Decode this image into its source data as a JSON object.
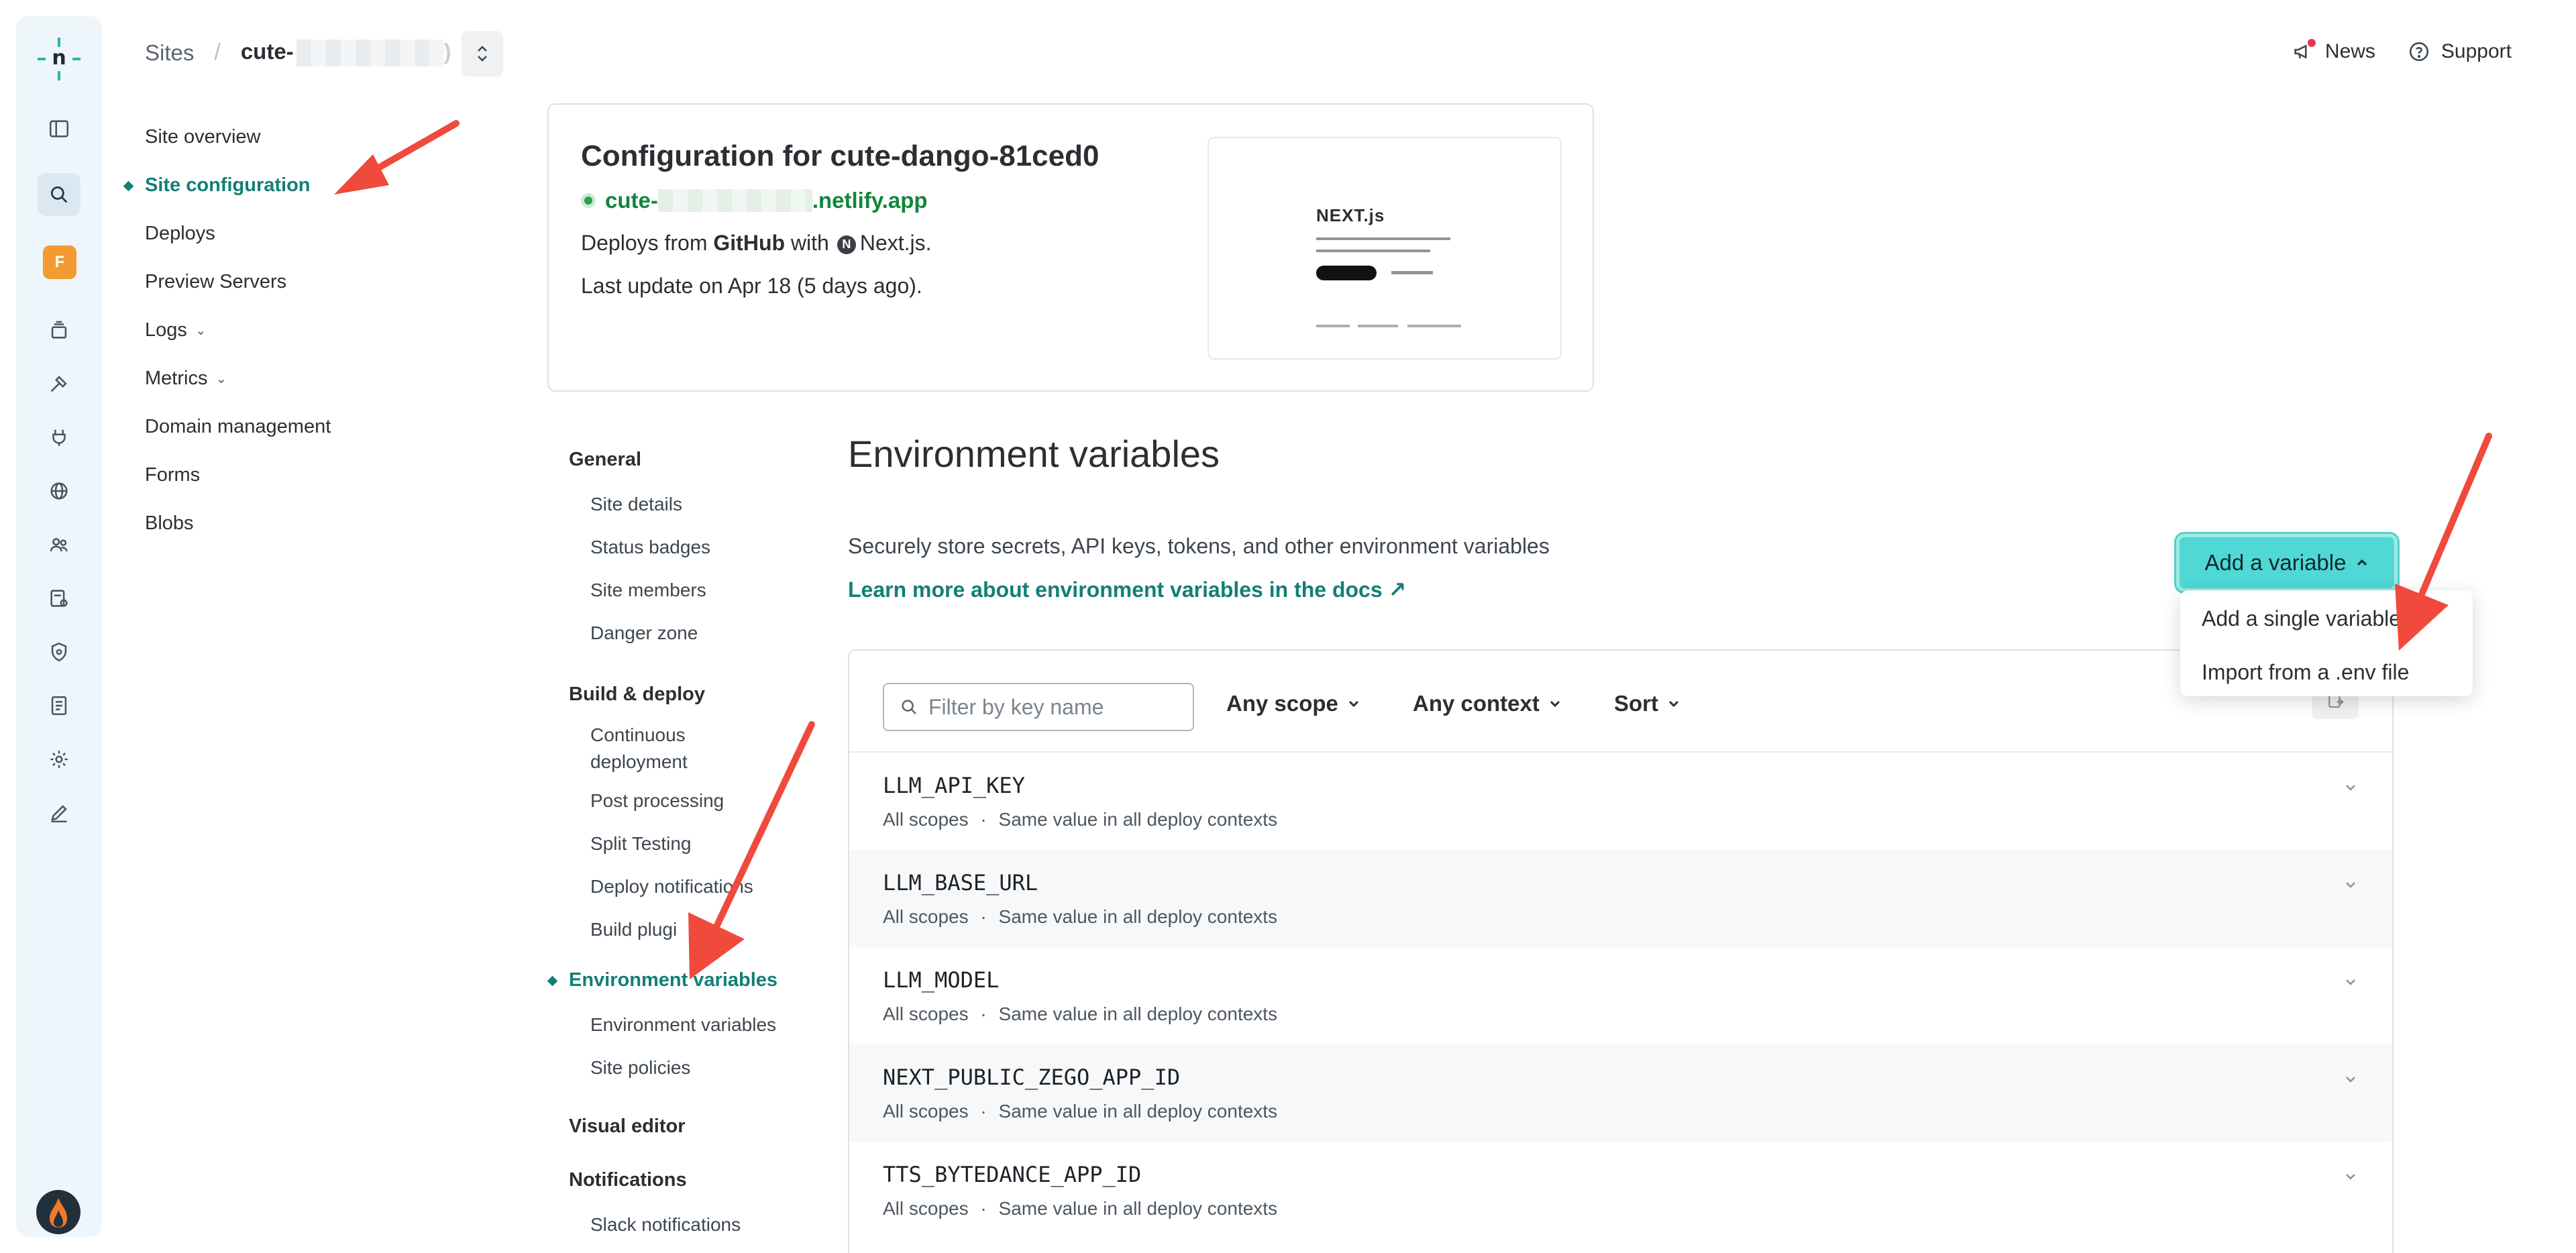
{
  "rail": {
    "icons": [
      "netlify-logo-icon",
      "sidebar-toggle-icon",
      "search-icon",
      "team-badge",
      "projects-icon",
      "builds-icon",
      "integrations-icon",
      "domains-icon",
      "members-icon",
      "audit-log-icon",
      "security-icon",
      "billing-icon",
      "settings-icon",
      "edit-icon",
      "avatar"
    ],
    "team_initial": "F"
  },
  "breadcrumb": {
    "sites": "Sites",
    "separator": "/",
    "site": "cute-",
    "site_suffix": ")"
  },
  "topbar": {
    "news": "News",
    "support": "Support"
  },
  "leftnav": [
    {
      "label": "Site overview",
      "active": false
    },
    {
      "label": "Site configuration",
      "active": true
    },
    {
      "label": "Deploys",
      "active": false
    },
    {
      "label": "Preview Servers",
      "active": false
    },
    {
      "label": "Logs",
      "active": false,
      "dropdown": true
    },
    {
      "label": "Metrics",
      "active": false,
      "dropdown": true
    },
    {
      "label": "Domain management",
      "active": false
    },
    {
      "label": "Forms",
      "active": false
    },
    {
      "label": "Blobs",
      "active": false
    }
  ],
  "card": {
    "title": "Configuration for cute-dango-81ced0",
    "url_prefix": "cute-",
    "url_suffix": ".netlify.app",
    "deploys_prefix": "Deploys from",
    "deploys_source": "GitHub",
    "deploys_with": "with",
    "framework": "Next.js.",
    "framework_icon": "N",
    "last_update": "Last update on Apr 18 (5 days ago).",
    "preview_title": "NEXT.js"
  },
  "subnav": {
    "general": "General",
    "general_items": [
      "Site details",
      "Status badges",
      "Site members",
      "Danger zone"
    ],
    "build": "Build & deploy",
    "build_items": [
      "Continuous deployment",
      "Post processing",
      "Split Testing",
      "Deploy notifications",
      "Build plugi"
    ],
    "env": "Environment variables",
    "env_items": [
      "Environment variables",
      "Site policies"
    ],
    "visual": "Visual editor",
    "notifications": "Notifications",
    "notif_items": [
      "Slack notifications"
    ]
  },
  "main": {
    "title": "Environment variables",
    "description": "Securely store secrets, API keys, tokens, and other environment variables",
    "link": "Learn more about environment variables in the docs ↗"
  },
  "add_variable": {
    "label": "Add a variable",
    "menu": [
      "Add a single variable",
      "Import from a .env file"
    ]
  },
  "filters": {
    "search_placeholder": "Filter by key name",
    "scope": "Any scope",
    "context": "Any context",
    "sort": "Sort"
  },
  "variables": [
    {
      "key": "LLM_API_KEY",
      "scopes": "All scopes",
      "dot": "·",
      "contexts": "Same value in all deploy contexts"
    },
    {
      "key": "LLM_BASE_URL",
      "scopes": "All scopes",
      "dot": "·",
      "contexts": "Same value in all deploy contexts"
    },
    {
      "key": "LLM_MODEL",
      "scopes": "All scopes",
      "dot": "·",
      "contexts": "Same value in all deploy contexts"
    },
    {
      "key": "NEXT_PUBLIC_ZEGO_APP_ID",
      "scopes": "All scopes",
      "dot": "·",
      "contexts": "Same value in all deploy contexts"
    },
    {
      "key": "TTS_BYTEDANCE_APP_ID",
      "scopes": "All scopes",
      "dot": "·",
      "contexts": "Same value in all deploy contexts"
    }
  ],
  "colors": {
    "accent": "#137f76",
    "button": "#4fd8d4",
    "annotation_arrow": "#ef4a3c",
    "rail": "#eef6fb"
  }
}
